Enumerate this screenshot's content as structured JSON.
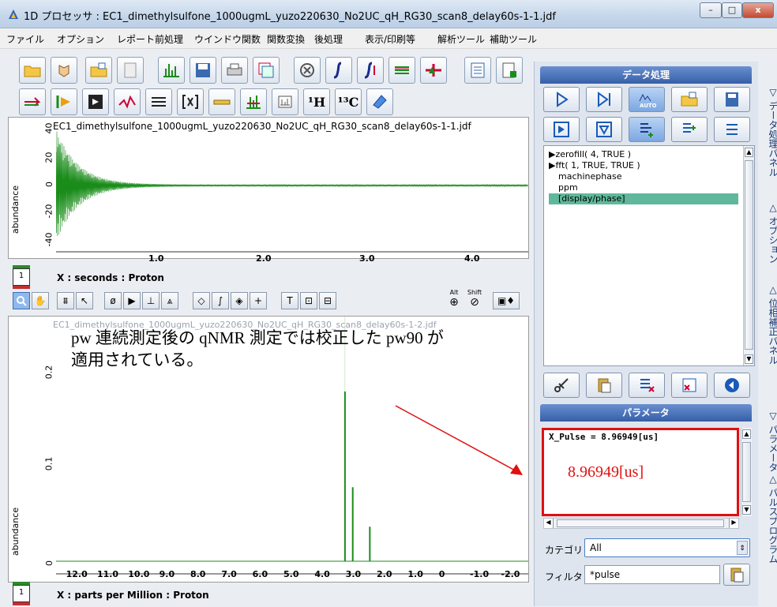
{
  "window": {
    "title": "1D プロセッサ : EC1_dimethylsulfone_1000ugmL_yuzo220630_No2UC_qH_RG30_scan8_delay60s-1-1.jdf",
    "minimize": "–",
    "maximize": "□",
    "close": "x"
  },
  "menu": [
    "ファイル",
    "オプション",
    "レポート",
    "前処理",
    "ウインドウ関数",
    "関数変換",
    "後処理",
    "表示/印刷等",
    "解析ツール",
    "補助ツール"
  ],
  "toolbar": {
    "row1_icons": [
      "open-folder-icon",
      "hand-process-icon",
      "open-file-icon",
      "reload-icon",
      "spectrum-icon",
      "save-icon",
      "print-icon",
      "multi-plot-icon",
      "cancel-icon",
      "integral-icon",
      "multi-integral-icon",
      "peak-list-icon",
      "phase-icon",
      "report-icon",
      "notes-icon"
    ],
    "row2_icons": [
      "arrow-process-icon",
      "play-spectrum-icon",
      "expand-icon",
      "baseline-icon",
      "align-icon",
      "bracket-icon",
      "ruler-icon",
      "peak-pick-icon",
      "zoom-window-icon",
      "proton-icon",
      "carbon-icon",
      "eraser-icon"
    ],
    "proton_label": "¹H",
    "carbon_label": "¹³C"
  },
  "fid_plot": {
    "filename": "EC1_dimethylsulfone_1000ugmL_yuzo220630_No2UC_qH_RG30_scan8_delay60s-1-1.jdf",
    "ylabel": "abundance",
    "yticks": [
      "40",
      "20",
      "0",
      "-20",
      "-40"
    ],
    "xticks": [
      "1.0",
      "2.0",
      "3.0",
      "4.0"
    ],
    "xcaption": "X : seconds : Proton",
    "row_index": "1"
  },
  "spectrum_toolbar": {
    "alt_label": "Alt",
    "shift_label": "Shift"
  },
  "spectrum_plot": {
    "filename": "EC1_dimethylsulfone_1000ugmL_yuzo220630_No2UC_qH_RG30_scan8_delay60s-1-2.jdf",
    "ylabel": "abundance",
    "yticks": [
      "0.2",
      "0.1",
      "0"
    ],
    "xticks": [
      "12.0",
      "11.0",
      "10.0",
      "9.0",
      "8.0",
      "7.0",
      "6.0",
      "5.0",
      "4.0",
      "3.0",
      "2.0",
      "1.0",
      "0",
      "-1.0",
      "-2.0"
    ],
    "xcaption": "X : parts per Million : Proton",
    "row_index": "1"
  },
  "annotation": {
    "line1": "pw 連続測定後の qNMR 測定では校正した pw90 が",
    "line2": "適用されている。",
    "value": "8.96949[us]",
    "color": "#e01010"
  },
  "data_panel": {
    "title": "データ処理",
    "auto_label": "AUTO",
    "commands": [
      "▶zerofill( 4, TRUE )",
      "▶fft( 1, TRUE, TRUE )",
      "machinephase",
      "ppm",
      "[display/phase]"
    ],
    "selected_index": 4
  },
  "param_panel": {
    "title": "パラメータ",
    "param_line": "X_Pulse = 8.96949[us]",
    "category_label": "カテゴリ",
    "category_value": "All",
    "filter_label": "フィルタ",
    "filter_value": "*pulse"
  },
  "side_tabs": [
    "▽ データ処理パネル",
    "△ オプション",
    "△ 位相補正パネル",
    "▽ パラメータ",
    "△ パルスプログラム"
  ],
  "colors": {
    "spectrum": "#1a8c1a",
    "panel_header": "#355fa8",
    "selection": "#5fb89b"
  }
}
